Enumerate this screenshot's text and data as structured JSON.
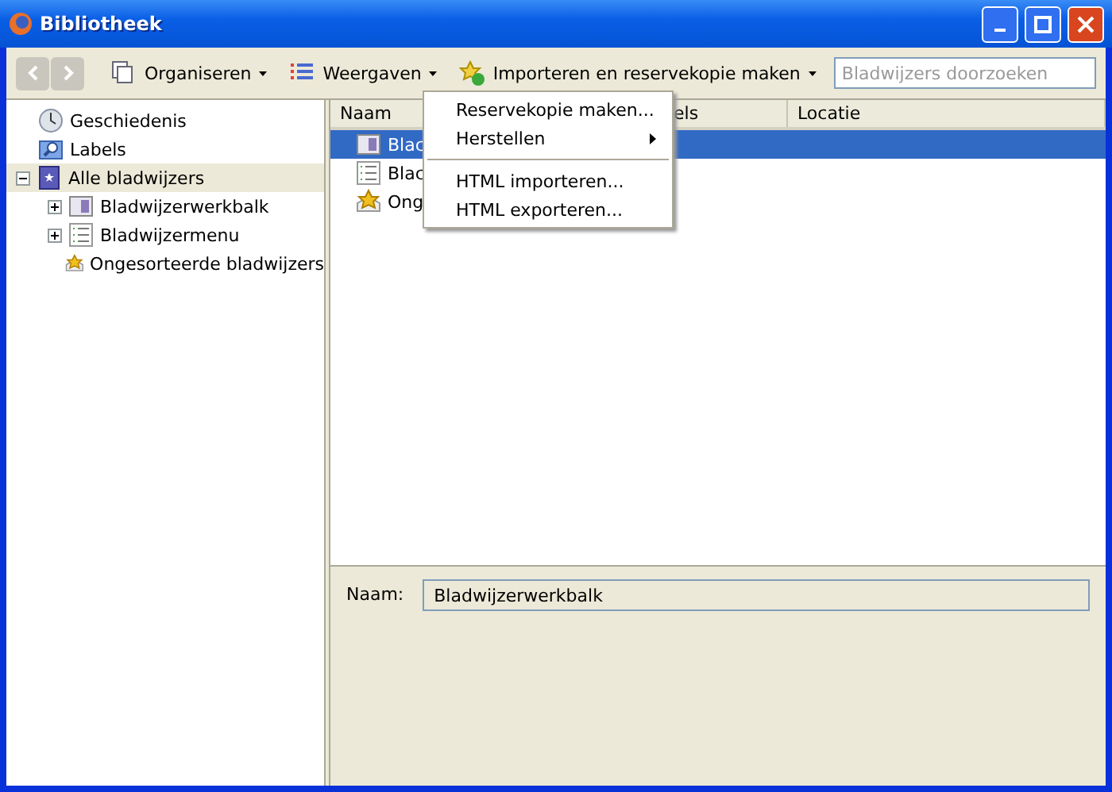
{
  "window": {
    "title": "Bibliotheek"
  },
  "toolbar": {
    "menus": [
      {
        "label": "Organiseren",
        "kind": "organize"
      },
      {
        "label": "Weergaven",
        "kind": "views"
      },
      {
        "label": "Importeren en reservekopie maken",
        "kind": "import"
      }
    ],
    "search": {
      "placeholder": "Bladwijzers doorzoeken"
    }
  },
  "sidebar": {
    "items": [
      {
        "label": "Geschiedenis",
        "kind": "history",
        "selected": false
      },
      {
        "label": "Labels",
        "kind": "labels",
        "selected": false
      },
      {
        "label": "Alle bladwijzers",
        "kind": "all",
        "selected": true,
        "expanded": true,
        "children": [
          {
            "label": "Bladwijzerwerkbalk",
            "kind": "toolbar",
            "selected": false,
            "expanded": false
          },
          {
            "label": "Bladwijzermenu",
            "kind": "menu",
            "selected": false,
            "expanded": false
          },
          {
            "label": "Ongesorteerde bladwijzers",
            "kind": "unsorted",
            "selected": false
          }
        ]
      }
    ]
  },
  "table": {
    "columns": [
      "Naam",
      "els",
      "Locatie"
    ],
    "rows": [
      {
        "name": "Blac",
        "kind": "toolbar",
        "selected": true
      },
      {
        "name": "Blac",
        "kind": "menu",
        "selected": false
      },
      {
        "name": "Ong",
        "kind": "unsorted",
        "selected": false
      }
    ]
  },
  "menu": {
    "items": [
      {
        "label": "Reservekopie maken...",
        "kind": "item"
      },
      {
        "label": "Herstellen",
        "kind": "submenu"
      },
      {
        "kind": "separator"
      },
      {
        "label": "HTML importeren...",
        "kind": "item"
      },
      {
        "label": "HTML exporteren...",
        "kind": "item"
      }
    ]
  },
  "details": {
    "label": "Naam:",
    "value": "Bladwijzerwerkbalk"
  }
}
